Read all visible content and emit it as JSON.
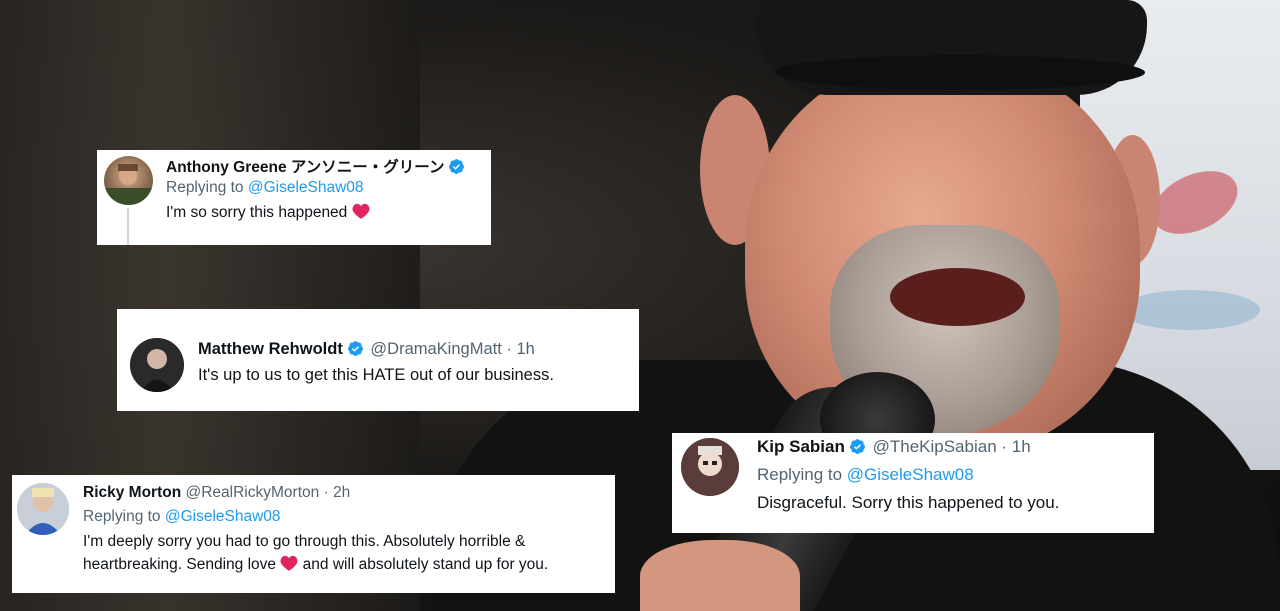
{
  "colors": {
    "verified_blue": "#1d9bf0",
    "mention_blue": "#1d9bf0",
    "heart_red": "#e0245e",
    "secondary_text": "#536471"
  },
  "tweets": [
    {
      "name": "Anthony Greene アンソニー・グリーン",
      "verified": true,
      "handle": "",
      "time": "",
      "reply_prefix": "Replying to",
      "reply_mention": "@GiseleShaw08",
      "text_lines": [
        "I'm so sorry this happened"
      ],
      "heart_icon": "heart-icon"
    },
    {
      "name": "Matthew Rehwoldt",
      "verified": true,
      "handle": "@DramaKingMatt",
      "time": "· 1h",
      "reply_prefix": "",
      "reply_mention": "",
      "text_lines": [
        "It's up to us to get this HATE out of our business."
      ]
    },
    {
      "name": "Kip Sabian",
      "verified": true,
      "handle": "@TheKipSabian",
      "time": "· 1h",
      "reply_prefix": "Replying to",
      "reply_mention": "@GiseleShaw08",
      "text_lines": [
        "Disgraceful. Sorry this happened to you."
      ]
    },
    {
      "name": "Ricky Morton",
      "verified": false,
      "handle": "@RealRickyMorton",
      "time": "· 2h",
      "reply_prefix": "Replying to",
      "reply_mention": "@GiseleShaw08",
      "text_lines": [
        "I'm deeply sorry you had to go through this. Absolutely horrible &",
        "heartbreaking. Sending love",
        "and will absolutely stand up for you."
      ]
    }
  ]
}
